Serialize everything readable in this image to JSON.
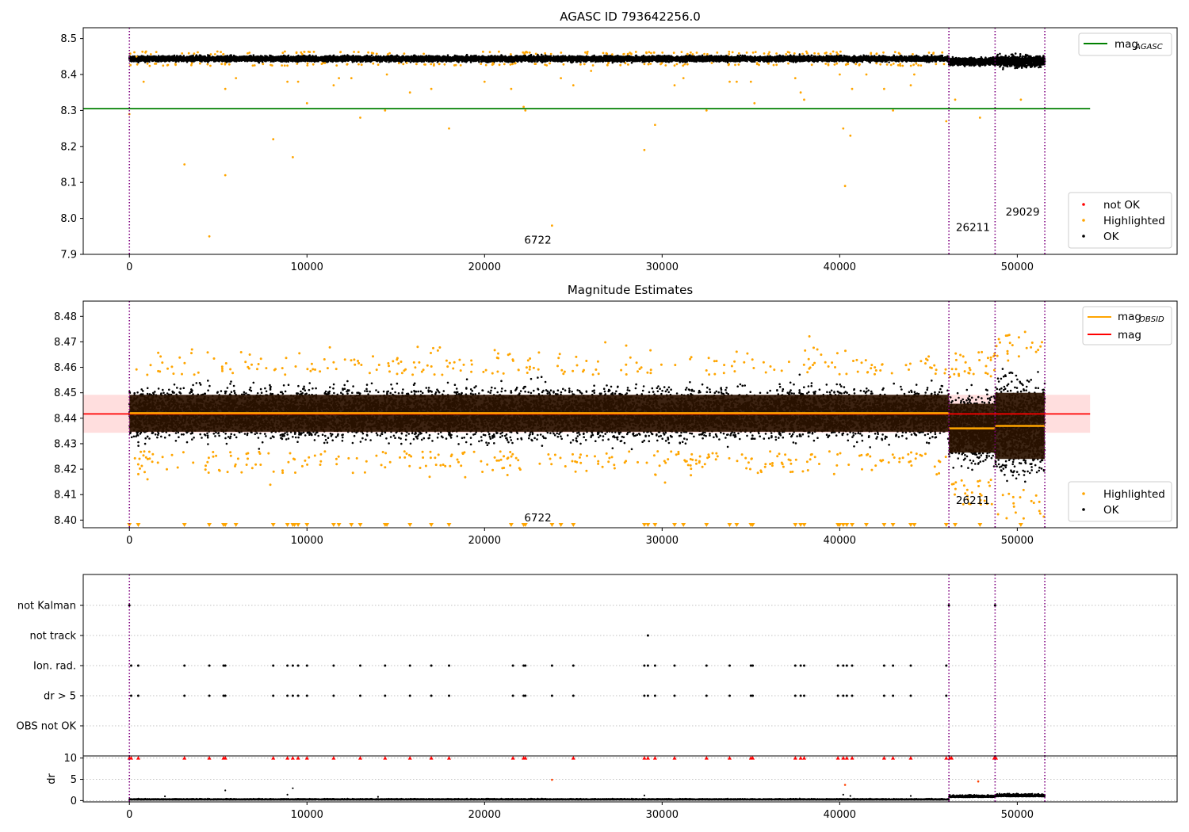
{
  "chart_data": [
    {
      "type": "scatter",
      "title": "AGASC ID 793642256.0",
      "xlabel": "",
      "ylabel": "",
      "xlim": [
        -2600,
        59000
      ],
      "ylim": [
        7.9,
        8.53
      ],
      "x_ticks": [
        0,
        10000,
        20000,
        30000,
        40000,
        50000
      ],
      "x_tick_labels": [
        "0",
        "10000",
        "20000",
        "30000",
        "40000",
        "50000"
      ],
      "y_ticks": [
        7.9,
        8.0,
        8.1,
        8.2,
        8.3,
        8.4,
        8.5
      ],
      "y_tick_labels": [
        "7.9",
        "8.0",
        "8.1",
        "8.2",
        "8.3",
        "8.4",
        "8.5"
      ],
      "grid": false,
      "obsid_boundaries": [
        0,
        46150,
        48750,
        51550
      ],
      "annotations": [
        {
          "text": "6722",
          "x": 23000,
          "y": 7.93
        },
        {
          "text": "26211",
          "x": 47500,
          "y": 7.965
        },
        {
          "text": "29029",
          "x": 50300,
          "y": 8.008
        }
      ],
      "reference_lines": [
        {
          "name": "mag_AGASC",
          "label_main": "mag",
          "label_sub": "AGASC",
          "color": "#008000",
          "y": 8.305,
          "x_range": [
            -2600,
            54100
          ]
        }
      ],
      "legend": {
        "lines_position": "top-right",
        "points_position": "bottom-right",
        "points": [
          {
            "name": "not OK",
            "color": "#ff0000"
          },
          {
            "name": "Highlighted",
            "color": "#ffa500"
          },
          {
            "name": "OK",
            "color": "#000000"
          }
        ]
      },
      "segments": [
        {
          "x_range": [
            0,
            46150
          ],
          "mean": 8.444,
          "spread": 0.006,
          "color": "#000000"
        },
        {
          "x_range": [
            46150,
            48750
          ],
          "mean": 8.436,
          "spread": 0.008,
          "color": "#000000"
        },
        {
          "x_range": [
            48750,
            51550
          ],
          "mean": 8.437,
          "spread": 0.012,
          "color": "#000000"
        }
      ],
      "highlighted_points": [
        [
          0,
          8.29
        ],
        [
          400,
          8.45
        ],
        [
          800,
          8.38
        ],
        [
          1500,
          8.43
        ],
        [
          3100,
          8.15
        ],
        [
          4500,
          7.95
        ],
        [
          5400,
          8.12
        ],
        [
          5400,
          8.36
        ],
        [
          6000,
          8.39
        ],
        [
          8100,
          8.22
        ],
        [
          8900,
          8.38
        ],
        [
          9200,
          8.17
        ],
        [
          9500,
          8.38
        ],
        [
          10000,
          8.32
        ],
        [
          11500,
          8.37
        ],
        [
          11800,
          8.39
        ],
        [
          12500,
          8.39
        ],
        [
          13000,
          8.28
        ],
        [
          14400,
          8.3
        ],
        [
          14500,
          8.4
        ],
        [
          15800,
          8.35
        ],
        [
          17000,
          8.36
        ],
        [
          18000,
          8.25
        ],
        [
          20000,
          8.38
        ],
        [
          21500,
          8.36
        ],
        [
          22200,
          8.31
        ],
        [
          22300,
          8.3
        ],
        [
          23800,
          7.98
        ],
        [
          24300,
          8.39
        ],
        [
          25000,
          8.37
        ],
        [
          26000,
          8.41
        ],
        [
          29000,
          8.19
        ],
        [
          29600,
          8.26
        ],
        [
          30700,
          8.37
        ],
        [
          31200,
          8.39
        ],
        [
          32500,
          8.3
        ],
        [
          33800,
          8.38
        ],
        [
          34200,
          8.38
        ],
        [
          35000,
          8.38
        ],
        [
          35200,
          8.32
        ],
        [
          37500,
          8.39
        ],
        [
          37800,
          8.35
        ],
        [
          38000,
          8.33
        ],
        [
          40000,
          8.4
        ],
        [
          40200,
          8.25
        ],
        [
          40300,
          8.09
        ],
        [
          40600,
          8.23
        ],
        [
          40700,
          8.36
        ],
        [
          41500,
          8.4
        ],
        [
          42500,
          8.36
        ],
        [
          43000,
          8.3
        ],
        [
          44000,
          8.37
        ],
        [
          44200,
          8.4
        ],
        [
          46000,
          8.27
        ],
        [
          46500,
          8.33
        ],
        [
          47900,
          8.28
        ],
        [
          50200,
          8.33
        ]
      ]
    },
    {
      "type": "scatter",
      "title": "Magnitude Estimates",
      "xlabel": "",
      "ylabel": "",
      "xlim": [
        -2600,
        59000
      ],
      "ylim": [
        8.397,
        8.486
      ],
      "x_ticks": [
        0,
        10000,
        20000,
        30000,
        40000,
        50000
      ],
      "x_tick_labels": [
        "0",
        "10000",
        "20000",
        "30000",
        "40000",
        "50000"
      ],
      "y_ticks": [
        8.4,
        8.41,
        8.42,
        8.43,
        8.44,
        8.45,
        8.46,
        8.47,
        8.48
      ],
      "y_tick_labels": [
        "8.40",
        "8.41",
        "8.42",
        "8.43",
        "8.44",
        "8.45",
        "8.46",
        "8.47",
        "8.48"
      ],
      "grid": false,
      "obsid_boundaries": [
        0,
        46150,
        48750,
        51550
      ],
      "annotations": [
        {
          "text": "6722",
          "x": 23000,
          "y": 8.3995
        },
        {
          "text": "26211",
          "x": 47500,
          "y": 8.4063
        }
      ],
      "reference_lines": [
        {
          "name": "mag_OBSID",
          "label_main": "mag",
          "label_sub": "OBSID",
          "color": "#ffa500",
          "segments": [
            {
              "x_range": [
                0,
                46150
              ],
              "y": 8.442
            },
            {
              "x_range": [
                46150,
                48750
              ],
              "y": 8.436
            },
            {
              "x_range": [
                48750,
                51550
              ],
              "y": 8.437
            }
          ]
        },
        {
          "name": "mag",
          "label_main": "mag",
          "label_sub": "",
          "color": "#ff0000",
          "y": 8.4417,
          "band": [
            8.4343,
            8.4492
          ],
          "x_range": [
            -2600,
            54100
          ]
        }
      ],
      "dark_bands": [
        {
          "x_range": [
            0,
            46150
          ],
          "y_range": [
            8.4347,
            8.4492
          ]
        },
        {
          "x_range": [
            46150,
            48750
          ],
          "y_range": [
            8.4265,
            8.4457
          ]
        },
        {
          "x_range": [
            48750,
            51550
          ],
          "y_range": [
            8.424,
            8.45
          ]
        }
      ],
      "legend": {
        "lines_position": "top-right",
        "points_position": "bottom-right",
        "points": [
          {
            "name": "Highlighted",
            "color": "#ffa500"
          },
          {
            "name": "OK",
            "color": "#000000"
          }
        ]
      },
      "segments": [
        {
          "x_range": [
            0,
            46150
          ],
          "mean": 8.442,
          "spread": 0.0075,
          "color": "#000000"
        },
        {
          "x_range": [
            46150,
            48750
          ],
          "mean": 8.436,
          "spread": 0.0095,
          "color": "#000000"
        },
        {
          "x_range": [
            48750,
            51550
          ],
          "mean": 8.437,
          "spread": 0.014,
          "color": "#000000"
        }
      ],
      "lower_limit_markers_x": [
        0,
        500,
        3100,
        4500,
        5300,
        5400,
        6000,
        8100,
        8900,
        9200,
        9300,
        9500,
        10000,
        11500,
        11800,
        12500,
        13000,
        14400,
        14500,
        15800,
        17000,
        18000,
        21500,
        22200,
        22300,
        23800,
        24300,
        25000,
        29000,
        29200,
        29600,
        30700,
        31200,
        32500,
        33800,
        34200,
        35000,
        35100,
        37500,
        37800,
        38000,
        39900,
        40000,
        40200,
        40400,
        40700,
        41500,
        42500,
        43000,
        44000,
        44200,
        46000,
        46500,
        47900,
        50200
      ]
    },
    {
      "type": "scatter",
      "title": "",
      "xlabel": "",
      "ylabel": "",
      "xlim": [
        -2600,
        59000
      ],
      "categories": [
        "not Kalman",
        "not track",
        "Ion. rad.",
        "dr > 5",
        "OBS not OK"
      ],
      "grid": true,
      "obsid_boundaries": [
        0,
        46150,
        48750,
        51550
      ],
      "flag_points": {
        "not Kalman": [
          0,
          46150,
          48750
        ],
        "not track": [
          29200
        ],
        "Ion. rad.": [
          100,
          500,
          3100,
          4500,
          5300,
          5400,
          8100,
          8900,
          9200,
          9500,
          10000,
          11500,
          13000,
          14400,
          15800,
          17000,
          18000,
          21600,
          22200,
          22300,
          23800,
          25000,
          29000,
          29200,
          29600,
          30700,
          32500,
          33800,
          35000,
          35100,
          37500,
          37800,
          38000,
          39900,
          40200,
          40400,
          40700,
          42500,
          43000,
          44000,
          46000
        ],
        "dr > 5": [
          100,
          500,
          3100,
          4500,
          5300,
          5400,
          8100,
          8900,
          9200,
          9500,
          10000,
          11500,
          13000,
          14400,
          15800,
          17000,
          18000,
          21600,
          22200,
          22300,
          23800,
          25000,
          29000,
          29200,
          29600,
          30700,
          32500,
          33800,
          35000,
          35100,
          37500,
          37800,
          38000,
          39900,
          40200,
          40400,
          40700,
          42500,
          43000,
          44000,
          46000
        ],
        "OBS not OK": []
      }
    },
    {
      "type": "scatter",
      "title": "",
      "xlabel": "",
      "ylabel": "dr",
      "xlim": [
        -2600,
        59000
      ],
      "ylim": [
        -0.3,
        10.5
      ],
      "x_ticks": [
        0,
        10000,
        20000,
        30000,
        40000,
        50000
      ],
      "x_tick_labels": [
        "0",
        "10000",
        "20000",
        "30000",
        "40000",
        "50000"
      ],
      "y_ticks": [
        0,
        5,
        10
      ],
      "y_tick_labels": [
        "0",
        "5",
        "10"
      ],
      "grid": true,
      "obsid_boundaries": [
        0,
        46150,
        48750,
        51550
      ],
      "segments": [
        {
          "x_range": [
            0,
            46150
          ],
          "mean": 0.25,
          "spread": 0.15,
          "color": "#000000"
        },
        {
          "x_range": [
            46150,
            48750
          ],
          "mean": 0.9,
          "spread": 0.35,
          "color": "#000000"
        },
        {
          "x_range": [
            48750,
            51550
          ],
          "mean": 1.1,
          "spread": 0.45,
          "color": "#000000"
        }
      ],
      "scattered_points": [
        [
          2000,
          1.0
        ],
        [
          5400,
          2.4
        ],
        [
          9200,
          2.9
        ],
        [
          8900,
          1.4
        ],
        [
          14000,
          0.9
        ],
        [
          29000,
          1.2
        ],
        [
          40200,
          1.4
        ],
        [
          40600,
          1.1
        ],
        [
          44000,
          1.1
        ]
      ],
      "capped_markers_x": [
        0,
        100,
        500,
        3100,
        4500,
        5300,
        5400,
        8100,
        8900,
        9200,
        9500,
        10000,
        11500,
        13000,
        14400,
        15800,
        17000,
        18000,
        21600,
        22200,
        22300,
        25000,
        29000,
        29200,
        29600,
        30700,
        32500,
        33800,
        35000,
        35100,
        37500,
        37800,
        38000,
        39900,
        40200,
        40400,
        40700,
        42500,
        43000,
        44000,
        46000,
        46200,
        46300,
        48700,
        48800
      ],
      "red_points": [
        [
          23800,
          4.9
        ],
        [
          40300,
          3.7
        ],
        [
          47800,
          4.5
        ]
      ]
    }
  ]
}
